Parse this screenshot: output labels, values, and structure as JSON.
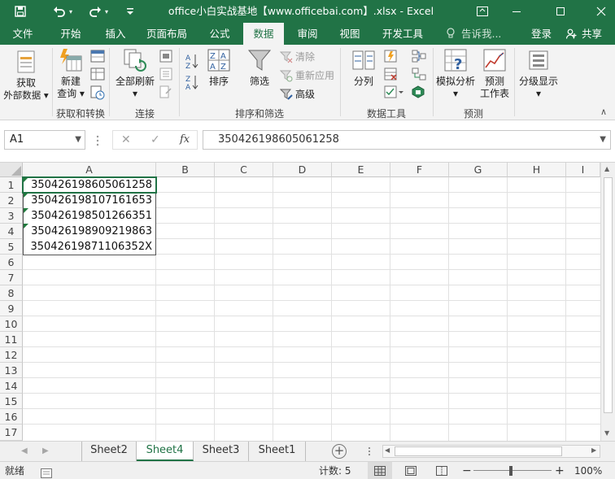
{
  "title_bar": {
    "title": "office小白实战基地【www.officebai.com】.xlsx - Excel"
  },
  "tabs": [
    {
      "label": "文件"
    },
    {
      "label": "开始"
    },
    {
      "label": "插入"
    },
    {
      "label": "页面布局"
    },
    {
      "label": "公式"
    },
    {
      "label": "数据",
      "active": true
    },
    {
      "label": "审阅"
    },
    {
      "label": "视图"
    },
    {
      "label": "开发工具"
    }
  ],
  "tell_me": "告诉我...",
  "login": "登录",
  "share": "共享",
  "ribbon": {
    "get_external_line1": "获取",
    "get_external_line2": "外部数据",
    "new_query_line1": "新建",
    "new_query_line2": "查询",
    "refresh_all": "全部刷新",
    "sort": "排序",
    "filter": "筛选",
    "clear": "清除",
    "reapply": "重新应用",
    "advanced": "高级",
    "text_to_columns": "分列",
    "what_if_line1": "模拟分析",
    "forecast_line1": "预测",
    "forecast_line2": "工作表",
    "outline": "分级显示",
    "groups": {
      "get_transform": "获取和转换",
      "connections": "连接",
      "sort_filter": "排序和筛选",
      "data_tools": "数据工具",
      "forecast": "预测"
    }
  },
  "formula_bar": {
    "name_box": "A1",
    "fx": "fx",
    "content": "350426198605061258"
  },
  "columns": [
    "A",
    "B",
    "C",
    "D",
    "E",
    "F",
    "G",
    "H",
    "I"
  ],
  "rows": [
    "1",
    "2",
    "3",
    "4",
    "5",
    "6",
    "7",
    "8",
    "9",
    "10",
    "11",
    "12",
    "13",
    "14",
    "15",
    "16",
    "17"
  ],
  "cells": [
    "350426198605061258",
    "350426198107161653",
    "350426198501266351",
    "350426198909219863",
    "35042619871106352X"
  ],
  "sheets": [
    {
      "label": "Sheet2"
    },
    {
      "label": "Sheet4",
      "active": true
    },
    {
      "label": "Sheet3"
    },
    {
      "label": "Sheet1"
    }
  ],
  "status": {
    "ready": "就绪",
    "count": "计数: 5",
    "zoom": "100%"
  },
  "colors": {
    "accent": "#217346",
    "error_triangle": "#1f7a3c"
  }
}
